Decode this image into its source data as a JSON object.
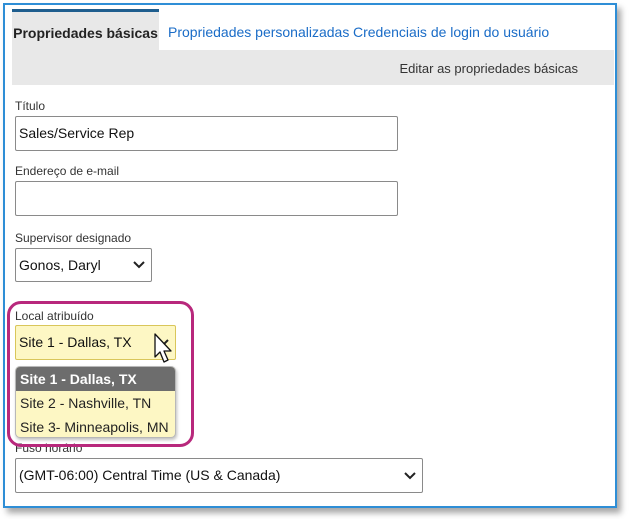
{
  "tabs": [
    {
      "label": "Propriedades básicas",
      "active": true
    },
    {
      "label": "Propriedades personalizadas",
      "active": false
    },
    {
      "label": "Credenciais de login do usuário",
      "active": false
    }
  ],
  "subbar": {
    "label": "Editar as propriedades básicas"
  },
  "form": {
    "title": {
      "label": "Título",
      "value": "Sales/Service Rep"
    },
    "email": {
      "label": "Endereço de e-mail",
      "value": ""
    },
    "supervisor": {
      "label": "Supervisor designado",
      "value": "Gonos, Daryl"
    },
    "location": {
      "label": "Local atribuído",
      "value": "Site 1 - Dallas, TX",
      "options": [
        "Site 1 - Dallas, TX",
        "Site 2 - Nashville, TN",
        "Site 3- Minneapolis, MN"
      ],
      "selected_index": 0
    },
    "timezone": {
      "label": "Fuso horário",
      "value": "(GMT-06:00) Central Time (US & Canada)"
    }
  },
  "colors": {
    "accent_link": "#1a6cc7",
    "frame_border": "#2e8ed6",
    "highlight_ring": "#b8287c",
    "dropdown_bg": "#fdf7c4",
    "selected_option_bg": "#6d6d6d"
  },
  "icons": [
    "chevron-down-icon",
    "mouse-pointer-icon"
  ]
}
